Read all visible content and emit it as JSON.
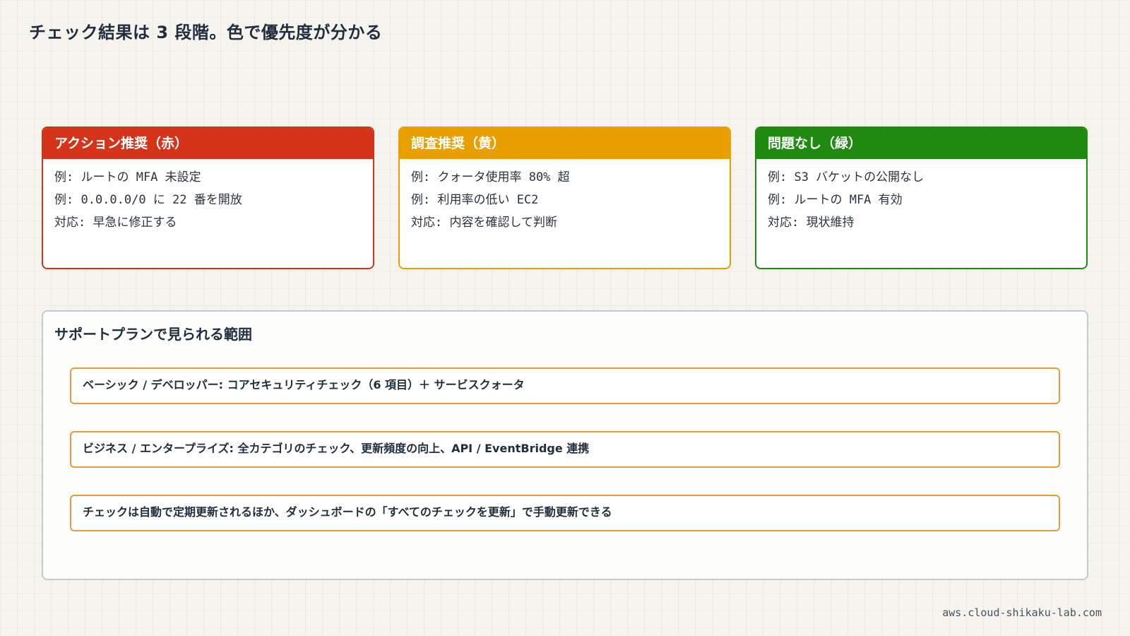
{
  "title": "チェック結果は 3 段階。色で優先度が分かる",
  "colors": {
    "red": "#d4351a",
    "yellow": "#e89f00",
    "green": "#1e8a10",
    "panel_border": "#c5cbd2",
    "row_border": "#e89a3c"
  },
  "cards": [
    {
      "header": "アクション推奨（赤）",
      "color": "#d4351a",
      "lines": [
        "例: ルートの MFA 未設定",
        "例: 0.0.0.0/0 に 22 番を開放",
        "対応: 早急に修正する"
      ]
    },
    {
      "header": "調査推奨（黄）",
      "color": "#e89f00",
      "lines": [
        "例: クォータ使用率 80% 超",
        "例: 利用率の低い EC2",
        "対応: 内容を確認して判断"
      ]
    },
    {
      "header": "問題なし（緑）",
      "color": "#1e8a10",
      "lines": [
        "例: S3 バケットの公開なし",
        "例: ルートの MFA 有効",
        "対応: 現状維持"
      ]
    }
  ],
  "support": {
    "title": "サポートプランで見られる範囲",
    "rows": [
      "ベーシック / デベロッパー: コアセキュリティチェック（6 項目）＋ サービスクォータ",
      "ビジネス / エンタープライズ: 全カテゴリのチェック、更新頻度の向上、API / EventBridge 連携",
      "チェックは自動で定期更新されるほか、ダッシュボードの「すべてのチェックを更新」で手動更新できる"
    ]
  },
  "footer": "aws.cloud-shikaku-lab.com"
}
